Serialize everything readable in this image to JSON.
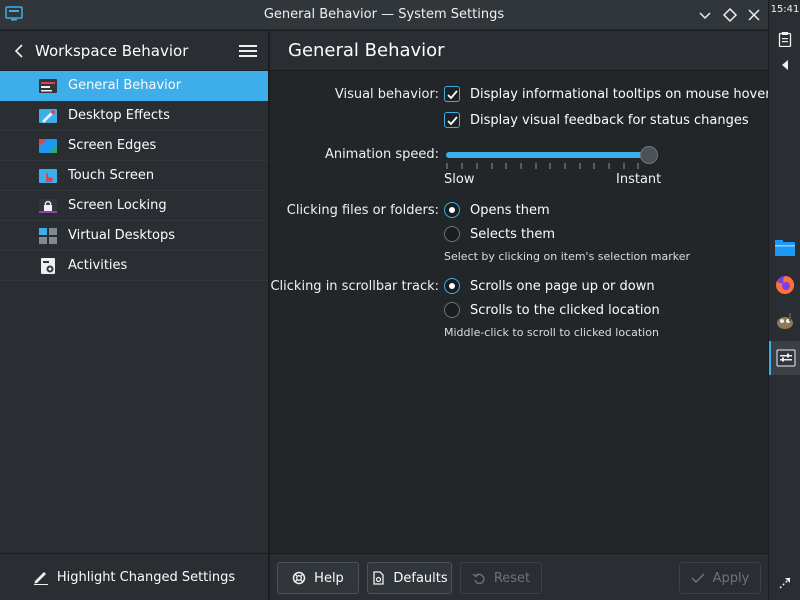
{
  "window": {
    "title": "General Behavior — System Settings"
  },
  "sidebar": {
    "header_title": "Workspace Behavior",
    "items": [
      {
        "label": "General Behavior",
        "active": true
      },
      {
        "label": "Desktop Effects",
        "active": false
      },
      {
        "label": "Screen Edges",
        "active": false
      },
      {
        "label": "Touch Screen",
        "active": false
      },
      {
        "label": "Screen Locking",
        "active": false
      },
      {
        "label": "Virtual Desktops",
        "active": false
      },
      {
        "label": "Activities",
        "active": false
      }
    ],
    "footer_label": "Highlight Changed Settings"
  },
  "page": {
    "title": "General Behavior",
    "visual_behavior": {
      "label": "Visual behavior:",
      "options": [
        {
          "label": "Display informational tooltips on mouse hover",
          "checked": true
        },
        {
          "label": "Display visual feedback for status changes",
          "checked": true
        }
      ]
    },
    "animation_speed": {
      "label": "Animation speed:",
      "min_label": "Slow",
      "max_label": "Instant",
      "value_fraction": 1.0
    },
    "clicking_files": {
      "label": "Clicking files or folders:",
      "options": [
        {
          "label": "Opens them",
          "selected": true
        },
        {
          "label": "Selects them",
          "selected": false
        }
      ],
      "hint": "Select by clicking on item's selection marker"
    },
    "scrollbar": {
      "label": "Clicking in scrollbar track:",
      "options": [
        {
          "label": "Scrolls one page up or down",
          "selected": true
        },
        {
          "label": "Scrolls to the clicked location",
          "selected": false
        }
      ],
      "hint": "Middle-click to scroll to clicked location"
    }
  },
  "footer": {
    "help": "Help",
    "defaults": "Defaults",
    "reset": "Reset",
    "apply": "Apply"
  },
  "panel": {
    "clock": "15:41"
  },
  "colors": {
    "accent": "#3daee9",
    "background": "#232629",
    "sidebar": "#2a2e32"
  }
}
